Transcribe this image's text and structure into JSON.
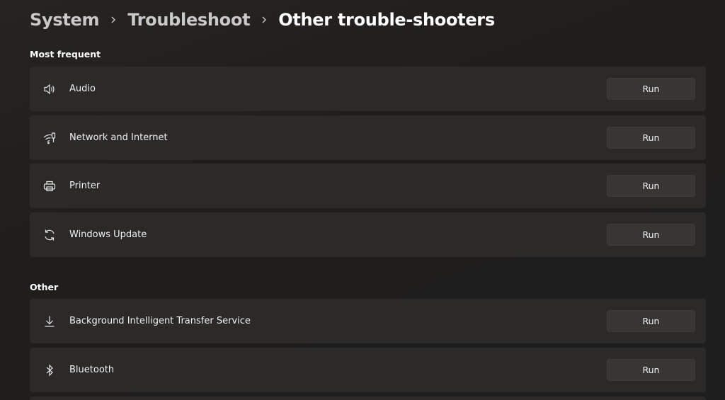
{
  "breadcrumb": {
    "items": [
      "System",
      "Troubleshoot"
    ],
    "current": "Other trouble-shooters"
  },
  "sections": {
    "most_frequent": {
      "label": "Most frequent",
      "items": [
        {
          "label": "Audio",
          "icon": "speaker-icon",
          "button": "Run"
        },
        {
          "label": "Network and Internet",
          "icon": "network-icon",
          "button": "Run"
        },
        {
          "label": "Printer",
          "icon": "printer-icon",
          "button": "Run"
        },
        {
          "label": "Windows Update",
          "icon": "sync-icon",
          "button": "Run"
        }
      ]
    },
    "other": {
      "label": "Other",
      "items": [
        {
          "label": "Background Intelligent Transfer Service",
          "icon": "download-icon",
          "button": "Run"
        },
        {
          "label": "Bluetooth",
          "icon": "bluetooth-icon",
          "button": "Run"
        }
      ]
    }
  },
  "colors": {
    "background": "#221f1d",
    "card": "#2b2a29",
    "button": "#373635",
    "text": "#ffffff"
  }
}
